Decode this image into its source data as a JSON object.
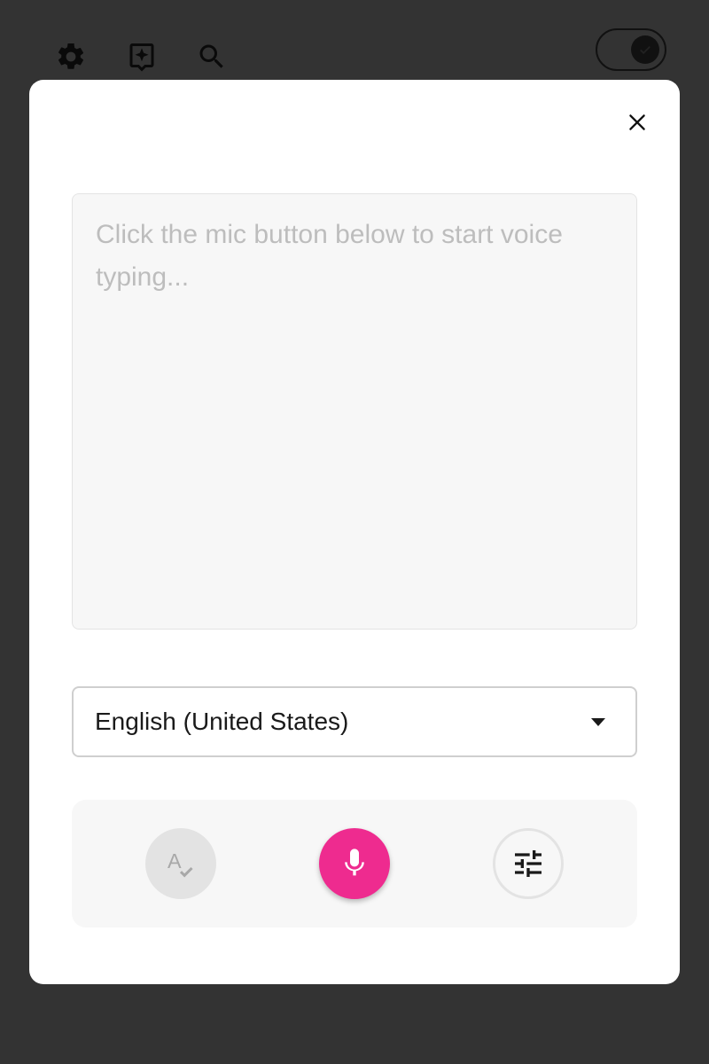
{
  "topbar": {
    "icons": [
      "gear-icon",
      "feedback-icon",
      "search-icon"
    ],
    "theme_toggle": {
      "state": "dark"
    }
  },
  "modal": {
    "transcript": {
      "placeholder": "Click the mic button below to start voice typing...",
      "value": ""
    },
    "language": {
      "selected": "English (United States)"
    },
    "controls": {
      "spellcheck_icon": "spellcheck-icon",
      "mic_icon": "mic-icon",
      "settings_icon": "tune-icon"
    }
  },
  "colors": {
    "backdrop": "#333333",
    "modal_bg": "#ffffff",
    "accent": "#ee2b8f",
    "panel_bg": "#f7f7f7",
    "disabled_bg": "#e3e3e3"
  }
}
